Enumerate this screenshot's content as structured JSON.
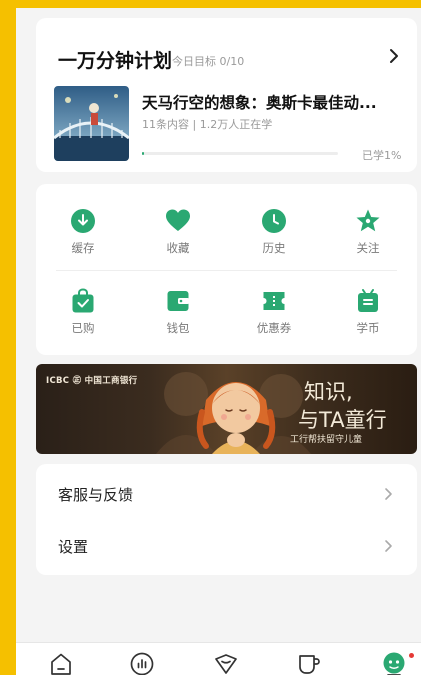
{
  "plan": {
    "title": "一万分钟计划",
    "goal": "今日目标 0/10",
    "course": {
      "title": "天马行空的想象：奥斯卡最佳动...",
      "meta": "11条内容 | 1.2万人正在学",
      "progress_percent": 1,
      "progress_label": "已学1%"
    }
  },
  "grid": {
    "items": [
      {
        "label": "缓存",
        "icon": "download-icon"
      },
      {
        "label": "收藏",
        "icon": "heart-icon"
      },
      {
        "label": "历史",
        "icon": "clock-icon"
      },
      {
        "label": "关注",
        "icon": "star-icon"
      },
      {
        "label": "已购",
        "icon": "shopping-bag-icon"
      },
      {
        "label": "钱包",
        "icon": "wallet-icon"
      },
      {
        "label": "优惠券",
        "icon": "coupon-icon"
      },
      {
        "label": "学币",
        "icon": "coin-icon"
      }
    ]
  },
  "banner": {
    "logo_text": "ICBC ㊣ 中国工商银行",
    "headline_1": "知识,",
    "headline_2": "与TA童行",
    "subtitle": "工行帮扶留守儿童"
  },
  "menu": {
    "items": [
      {
        "label": "客服与反馈"
      },
      {
        "label": "设置"
      }
    ]
  },
  "tabbar": {
    "items": [
      "home-icon",
      "stats-icon",
      "discover-icon",
      "cup-icon",
      "profile-icon"
    ],
    "active": 4
  },
  "colors": {
    "accent_green": "#2aa872",
    "background": "#f4f4f4",
    "frame_yellow": "#f5c000",
    "notification_red": "#e53935"
  }
}
